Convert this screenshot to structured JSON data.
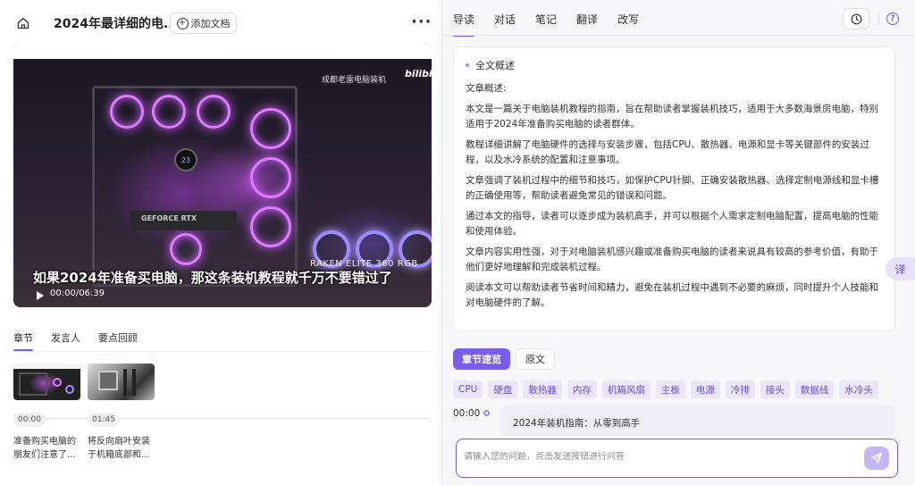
{
  "header": {
    "doc_title": "2024年最详细的电...",
    "add_doc_label": "添加文档"
  },
  "video": {
    "watermark": "成都老雷电脑装机",
    "brand": "bilibili",
    "gpu_label": "GEFORCE RTX",
    "aio_value": "23",
    "product_label": "RAKEN ELITE 360 RGB",
    "subtitle": "如果2024年准备买电脑，那这条装机教程就千万不要错过了",
    "time": "00:00/06:39"
  },
  "left_tabs": [
    {
      "label": "章节"
    },
    {
      "label": "发言人"
    },
    {
      "label": "要点回顾"
    }
  ],
  "chapters": [
    {
      "time": "00:00",
      "text": "准备购买电脑的朋友们注意了..."
    },
    {
      "time": "01:45",
      "text": "将反向扇叶安装于机箱底部和..."
    }
  ],
  "right_tabs": [
    {
      "label": "导读"
    },
    {
      "label": "对话"
    },
    {
      "label": "笔记"
    },
    {
      "label": "翻译"
    },
    {
      "label": "改写"
    }
  ],
  "help_label": "?",
  "summary": {
    "heading": "全文概述",
    "lead": "文章概述:",
    "paragraphs": [
      "本文是一篇关于电脑装机教程的指南，旨在帮助读者掌握装机技巧，适用于大多数海景房电脑，特别适用于2024年准备购买电脑的读者群体。",
      "教程详细讲解了电脑硬件的选择与安装步骤，包括CPU、散热器、电源和显卡等关键部件的安装过程，以及水冷系统的配置和注意事项。",
      "文章强调了装机过程中的细节和技巧，如保护CPU针脚、正确安装散热器、选择定制电源线和显卡槽的正确使用等，帮助读者避免常见的错误和问题。",
      "通过本文的指导，读者可以逐步成为装机高手，并可以根据个人需求定制电脑配置，提高电脑的性能和使用体验。",
      "文章内容实用性强，对于对电脑装机感兴趣或准备购买电脑的读者来说具有较高的参考价值，有助于他们更好地理解和完成装机过程。",
      "阅读本文可以帮助读者节省时间和精力，避免在装机过程中遇到不必要的麻烦，同时提升个人技能和对电脑硬件的了解。"
    ]
  },
  "chapter_tabs": [
    {
      "label": "章节速览"
    },
    {
      "label": "原文"
    }
  ],
  "tags": [
    "CPU",
    "硬盘",
    "散热器",
    "内存",
    "机箱风扇",
    "主板",
    "电源",
    "冷排",
    "接头",
    "数据线",
    "水冷头"
  ],
  "chapter_row": {
    "time": "00:00",
    "title": "2024年装机指南：从零到高手"
  },
  "ask": {
    "placeholder": "请输入您的问题，点击发送按钮进行问答"
  },
  "translate_float_label": "译",
  "colors": {
    "accent": "#7b5cf0",
    "tag_bg": "#ebe6fb"
  }
}
